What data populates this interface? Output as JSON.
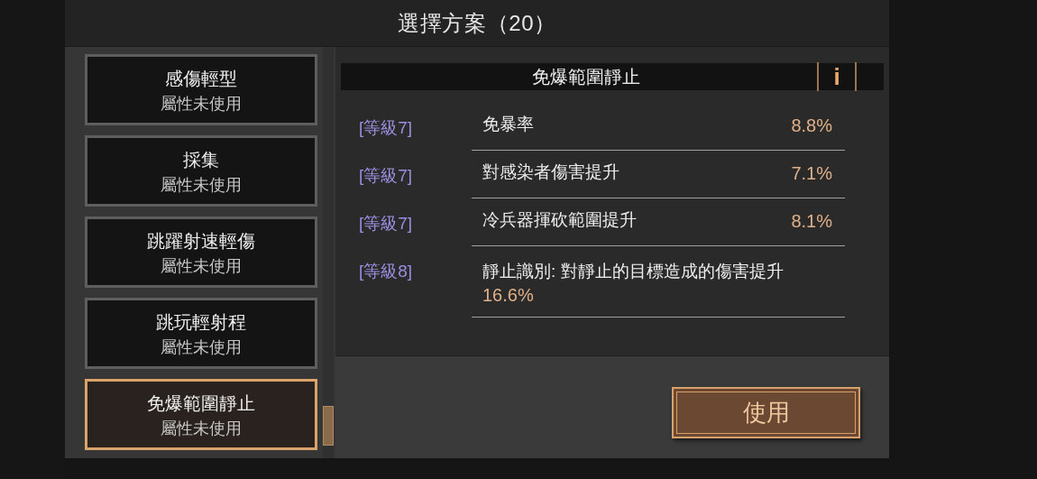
{
  "dialog": {
    "title": "選擇方案（20）"
  },
  "plans": [
    {
      "name": "感傷輕型",
      "status": "屬性未使用",
      "selected": false
    },
    {
      "name": "採集",
      "status": "屬性未使用",
      "selected": false
    },
    {
      "name": "跳躍射速輕傷",
      "status": "屬性未使用",
      "selected": false
    },
    {
      "name": "跳玩輕射程",
      "status": "屬性未使用",
      "selected": false
    },
    {
      "name": "免爆範圍靜止",
      "status": "屬性未使用",
      "selected": true
    }
  ],
  "detail": {
    "title": "免爆範圍靜止",
    "info_icon": "i",
    "stats": [
      {
        "kind": "split",
        "level": "[等級7]",
        "name": "免暴率",
        "value": "8.8%"
      },
      {
        "kind": "split",
        "level": "[等級7]",
        "name": "對感染者傷害提升",
        "value": "7.1%"
      },
      {
        "kind": "split",
        "level": "[等級7]",
        "name": "冷兵器揮砍範圍提升",
        "value": "8.1%"
      },
      {
        "kind": "inline",
        "level": "[等級8]",
        "name": "靜止識別: 對靜止的目標造成的傷害提升",
        "value": "16.6%"
      }
    ]
  },
  "use_button": "使用"
}
